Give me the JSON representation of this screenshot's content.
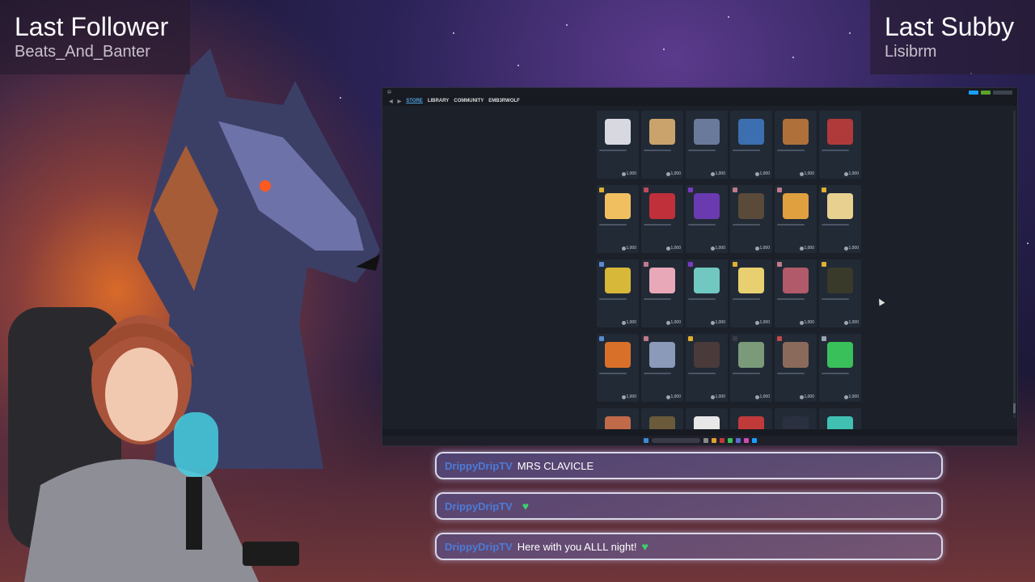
{
  "overlay": {
    "last_follower_title": "Last Follower",
    "last_follower_name": "Beats_And_Banter",
    "last_subby_title": "Last Subby",
    "last_subby_name": "Lisibrm"
  },
  "steam": {
    "nav": [
      "STORE",
      "LIBRARY",
      "COMMUNITY",
      "EMB3RWOLF"
    ],
    "active_nav": "STORE",
    "price": "1,000"
  },
  "chat": [
    {
      "user": "DrippyDripTV",
      "message": "MRS CLAVICLE",
      "heart": false
    },
    {
      "user": "DrippyDripTV",
      "message": "",
      "heart": true
    },
    {
      "user": "DrippyDripTV",
      "message": "Here with you ALLL night!",
      "heart": true
    }
  ],
  "colors": {
    "accent_link": "#4fa3e0",
    "chat_user": "#4c7bd8",
    "heart": "#3ad26b"
  }
}
